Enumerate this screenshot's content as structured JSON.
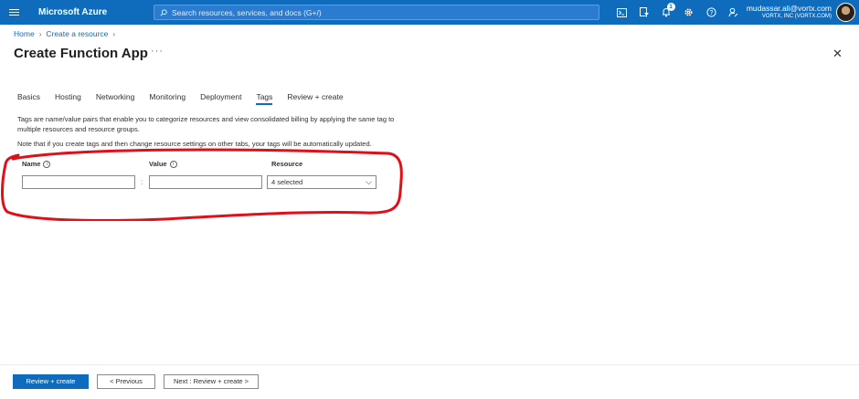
{
  "header": {
    "brand": "Microsoft Azure",
    "search_placeholder": "Search resources, services, and docs (G+/)",
    "notification_count": "1",
    "account_email": "mudassar.ali@vortx.com",
    "account_tenant": "VORTX, INC (VORTX.COM)",
    "icons": [
      "cloud-shell-icon",
      "directory-filter-icon",
      "bell-icon",
      "gear-icon",
      "help-icon",
      "feedback-icon"
    ]
  },
  "breadcrumb": {
    "items": [
      "Home",
      "Create a resource"
    ]
  },
  "page": {
    "title": "Create Function App",
    "more": "···",
    "close": "✕"
  },
  "tabs": [
    {
      "label": "Basics",
      "active": false
    },
    {
      "label": "Hosting",
      "active": false
    },
    {
      "label": "Networking",
      "active": false
    },
    {
      "label": "Monitoring",
      "active": false
    },
    {
      "label": "Deployment",
      "active": false
    },
    {
      "label": "Tags",
      "active": true
    },
    {
      "label": "Review + create",
      "active": false
    }
  ],
  "content": {
    "description": "Tags are name/value pairs that enable you to categorize resources and view consolidated billing by applying the same tag to multiple resources and resource groups.",
    "note": "Note that if you create tags and then change resource settings on other tabs, your tags will be automatically updated."
  },
  "tag_table": {
    "headers": {
      "name": "Name",
      "value": "Value",
      "resource": "Resource"
    },
    "row": {
      "name": "",
      "value": "",
      "separator": ":",
      "resource": "4 selected"
    }
  },
  "footer": {
    "review_create": "Review + create",
    "previous": "< Previous",
    "next": "Next : Review + create >"
  },
  "colors": {
    "accent": "#0f6cbd",
    "annotation": "#e0101a"
  }
}
